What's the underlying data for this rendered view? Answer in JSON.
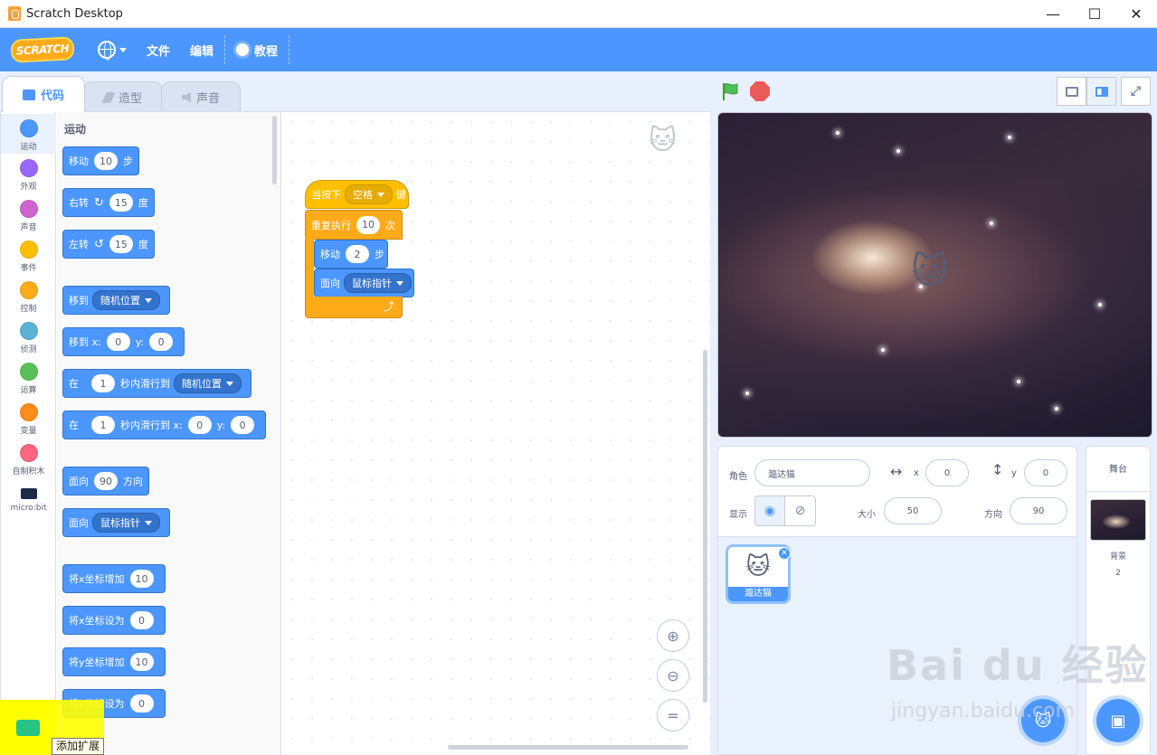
{
  "window": {
    "title": "Scratch Desktop",
    "controls": [
      "—",
      "☐",
      "✕"
    ]
  },
  "menubar": {
    "logo": "SCRATCH",
    "file": "文件",
    "edit": "编辑",
    "tutorials": "教程"
  },
  "tabs": {
    "code": "代码",
    "costumes": "造型",
    "sounds": "声音"
  },
  "categories": [
    {
      "label": "运动",
      "color": "#4c97ff"
    },
    {
      "label": "外观",
      "color": "#9966ff"
    },
    {
      "label": "声音",
      "color": "#cf63cf"
    },
    {
      "label": "事件",
      "color": "#ffbf00"
    },
    {
      "label": "控制",
      "color": "#ffab19"
    },
    {
      "label": "侦测",
      "color": "#5cb1d6"
    },
    {
      "label": "运算",
      "color": "#59c059"
    },
    {
      "label": "变量",
      "color": "#ff8c1a"
    },
    {
      "label": "自制积木",
      "color": "#ff6680"
    },
    {
      "label": "micro:bit",
      "color": "#1e2a4a"
    }
  ],
  "palette": {
    "section": "运动",
    "move": {
      "a": "移动",
      "v": "10",
      "b": "步"
    },
    "turn_right": {
      "a": "右转",
      "v": "15",
      "b": "度"
    },
    "turn_left": {
      "a": "左转",
      "v": "15",
      "b": "度"
    },
    "goto": {
      "a": "移到",
      "d": "随机位置"
    },
    "goto_xy": {
      "a": "移到 x:",
      "x": "0",
      "ylab": "y:",
      "y": "0"
    },
    "glide": {
      "a": "在",
      "v": "1",
      "b": "秒内滑行到",
      "d": "随机位置"
    },
    "glide_xy": {
      "a": "在",
      "v": "1",
      "b": "秒内滑行到 x:",
      "x": "0",
      "ylab": "y:",
      "y": "0"
    },
    "point_dir": {
      "a": "面向",
      "v": "90",
      "b": "方向"
    },
    "point_towards": {
      "a": "面向",
      "d": "鼠标指针"
    },
    "change_x": {
      "a": "将x坐标增加",
      "v": "10"
    },
    "set_x": {
      "a": "将x坐标设为",
      "v": "0"
    },
    "change_y": {
      "a": "将y坐标增加",
      "v": "10"
    },
    "set_y": {
      "a": "将y坐标设为",
      "v": "0"
    }
  },
  "script": {
    "when_key": {
      "a": "当按下",
      "d": "空格",
      "b": "键"
    },
    "repeat": {
      "a": "重复执行",
      "v": "10",
      "b": "次"
    },
    "move": {
      "a": "移动",
      "v": "2",
      "b": "步"
    },
    "point": {
      "a": "面向",
      "d": "鼠标指针"
    },
    "loop_arrow": "⤴"
  },
  "zoom": {
    "in": "⊕",
    "out": "⊖",
    "reset": "="
  },
  "extension": {
    "tooltip": "添加扩展"
  },
  "sprite_info": {
    "sprite_label": "角色",
    "sprite_name": "瀶达猫",
    "x_label": "x",
    "x": "0",
    "y_label": "y",
    "y": "0",
    "show_label": "显示",
    "size_label": "大小",
    "size": "50",
    "direction_label": "方向",
    "direction": "90"
  },
  "sprite_list": [
    {
      "name": "瀶达猫"
    }
  ],
  "stage_pane": {
    "title": "舞台",
    "backdrops_label": "背景",
    "backdrops_count": "2"
  },
  "watermark": {
    "brand": "Bai du 经验",
    "url": "jingyan.baidu.com"
  }
}
